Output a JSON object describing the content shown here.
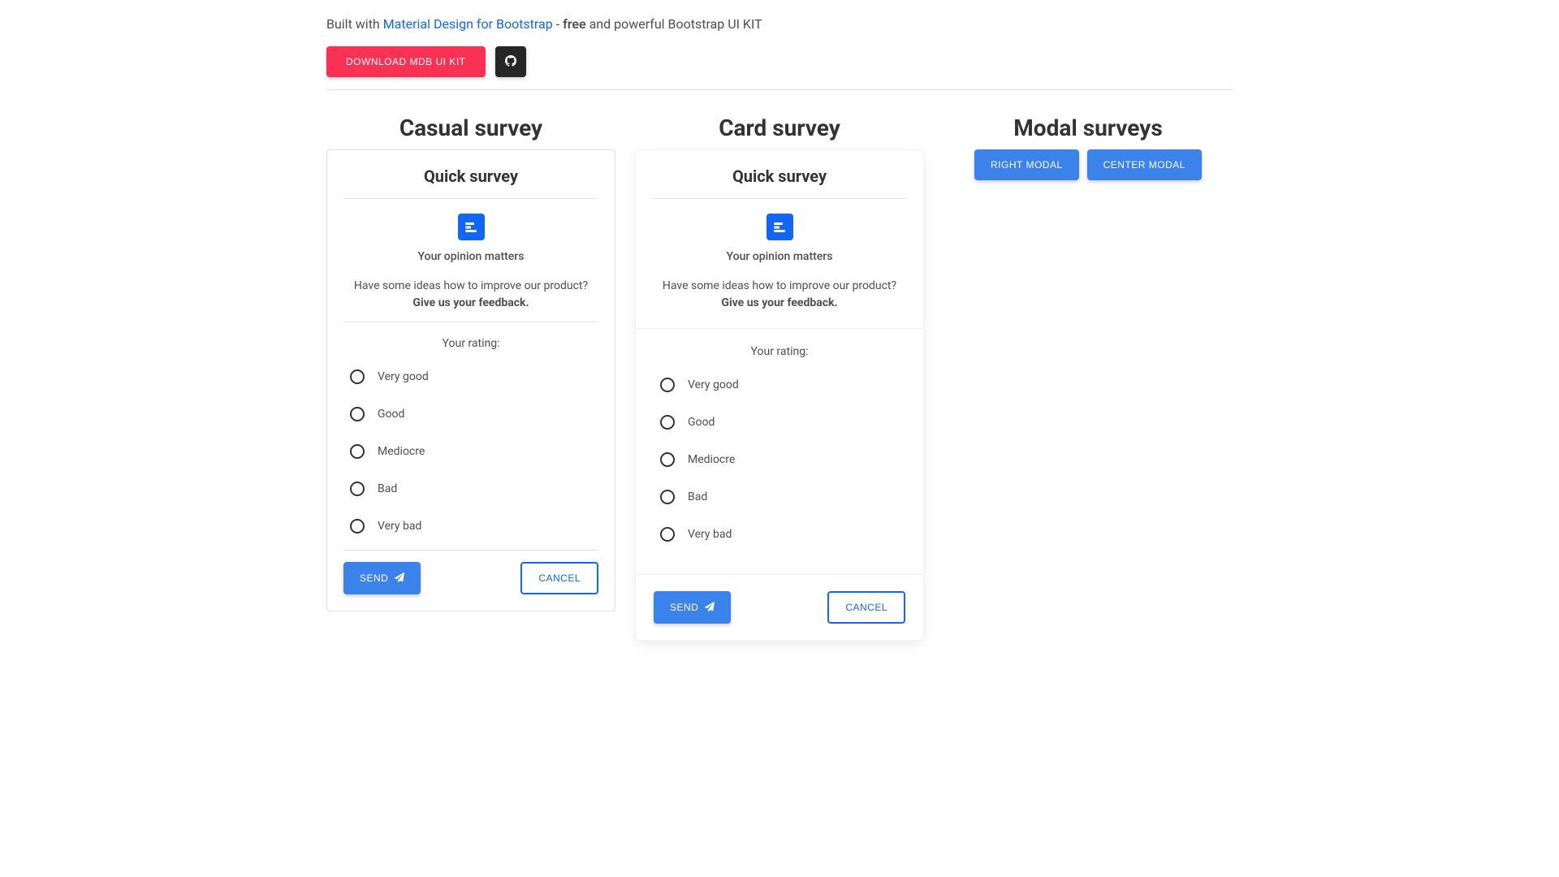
{
  "header": {
    "prefix": "Built with ",
    "link_text": "Material Design for Bootstrap",
    "dash": " - ",
    "free": "free",
    "suffix": " and powerful Bootstrap UI KIT",
    "download_label": "DOWNLOAD MDB UI KIT"
  },
  "casual": {
    "title": "Casual survey",
    "panel_title": "Quick survey",
    "opinion": "Your opinion matters",
    "desc_prefix": "Have some ideas how to improve our product? ",
    "desc_bold": "Give us your feedback.",
    "rating_label": "Your rating:",
    "options": [
      "Very good",
      "Good",
      "Mediocre",
      "Bad",
      "Very bad"
    ],
    "send": "SEND",
    "cancel": "CANCEL"
  },
  "card": {
    "title": "Card survey",
    "panel_title": "Quick survey",
    "opinion": "Your opinion matters",
    "desc_prefix": "Have some ideas how to improve our product? ",
    "desc_bold": "Give us your feedback.",
    "rating_label": "Your rating:",
    "options": [
      "Very good",
      "Good",
      "Mediocre",
      "Bad",
      "Very bad"
    ],
    "send": "SEND",
    "cancel": "CANCEL"
  },
  "modal": {
    "title": "Modal surveys",
    "right": "RIGHT MODAL",
    "center": "CENTER MODAL"
  }
}
